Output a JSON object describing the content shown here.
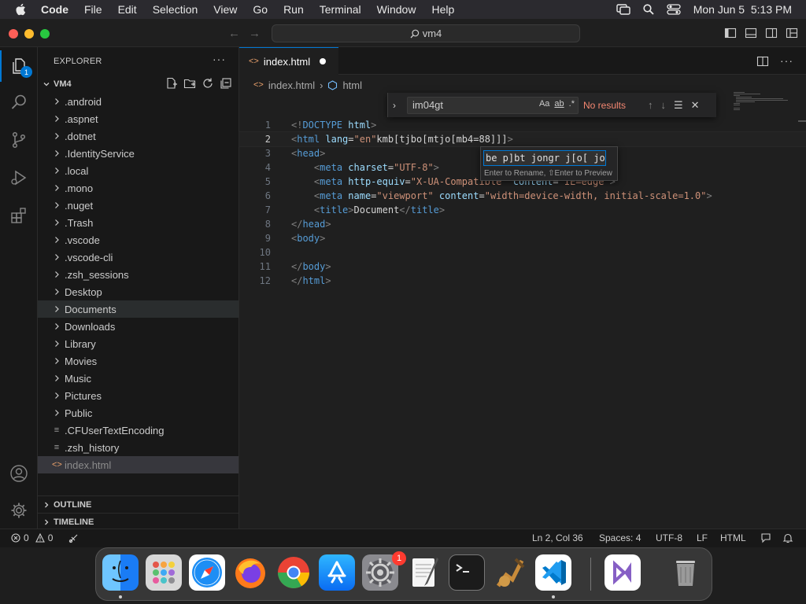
{
  "menubar": {
    "app_name": "Code",
    "items": [
      "File",
      "Edit",
      "Selection",
      "View",
      "Go",
      "Run",
      "Terminal",
      "Window",
      "Help"
    ],
    "datetime": "Mon Jun 5  5:13 PM"
  },
  "titlebar": {
    "search_label": "vm4"
  },
  "activitybar": {
    "explorer_badge": "1"
  },
  "sidebar": {
    "title": "EXPLORER",
    "more_actions": "···",
    "root": "VM4",
    "items": [
      {
        "label": ".android",
        "kind": "folder"
      },
      {
        "label": ".aspnet",
        "kind": "folder"
      },
      {
        "label": ".dotnet",
        "kind": "folder"
      },
      {
        "label": ".IdentityService",
        "kind": "folder"
      },
      {
        "label": ".local",
        "kind": "folder"
      },
      {
        "label": ".mono",
        "kind": "folder"
      },
      {
        "label": ".nuget",
        "kind": "folder"
      },
      {
        "label": ".Trash",
        "kind": "folder"
      },
      {
        "label": ".vscode",
        "kind": "folder"
      },
      {
        "label": ".vscode-cli",
        "kind": "folder"
      },
      {
        "label": ".zsh_sessions",
        "kind": "folder"
      },
      {
        "label": "Desktop",
        "kind": "folder"
      },
      {
        "label": "Documents",
        "kind": "folder"
      },
      {
        "label": "Downloads",
        "kind": "folder"
      },
      {
        "label": "Library",
        "kind": "folder"
      },
      {
        "label": "Movies",
        "kind": "folder"
      },
      {
        "label": "Music",
        "kind": "folder"
      },
      {
        "label": "Pictures",
        "kind": "folder"
      },
      {
        "label": "Public",
        "kind": "folder"
      },
      {
        "label": ".CFUserTextEncoding",
        "kind": "file"
      },
      {
        "label": ".zsh_history",
        "kind": "file"
      },
      {
        "label": "index.html",
        "kind": "html"
      }
    ],
    "outline": "OUTLINE",
    "timeline": "TIMELINE"
  },
  "editor": {
    "tab_label": "index.html",
    "breadcrumb_file": "index.html",
    "breadcrumb_symbol": "html",
    "line_numbers": [
      "1",
      "2",
      "3",
      "4",
      "5",
      "6",
      "7",
      "8",
      "9",
      "10",
      "11",
      "12"
    ],
    "lines": [
      [
        [
          "br",
          "<!"
        ],
        [
          "tg",
          "DOCTYPE"
        ],
        [
          "pl",
          " "
        ],
        [
          "at",
          "html"
        ],
        [
          "br",
          ">"
        ]
      ],
      [
        [
          "br",
          "<"
        ],
        [
          "tg",
          "html"
        ],
        [
          "pl",
          " "
        ],
        [
          "at",
          "lang"
        ],
        [
          "pl",
          "="
        ],
        [
          "st",
          "\"en\""
        ],
        [
          "pl",
          "kmb[tjbo[mtjo[mb4=88]]]"
        ],
        [
          "br",
          ">"
        ]
      ],
      [
        [
          "br",
          "<"
        ],
        [
          "tg",
          "head"
        ],
        [
          "br",
          ">"
        ]
      ],
      [
        [
          "pl",
          "    "
        ],
        [
          "br",
          "<"
        ],
        [
          "tg",
          "meta"
        ],
        [
          "pl",
          " "
        ],
        [
          "at",
          "charset"
        ],
        [
          "pl",
          "="
        ],
        [
          "st",
          "\"UTF-8\""
        ],
        [
          "br",
          ">"
        ]
      ],
      [
        [
          "pl",
          "    "
        ],
        [
          "br",
          "<"
        ],
        [
          "tg",
          "meta"
        ],
        [
          "pl",
          " "
        ],
        [
          "at",
          "http-equiv"
        ],
        [
          "pl",
          "="
        ],
        [
          "st",
          "\"X-UA-Compatible\""
        ],
        [
          "pl",
          " "
        ],
        [
          "at",
          "content"
        ],
        [
          "pl",
          "="
        ],
        [
          "st",
          "\"IE=edge\""
        ],
        [
          "br",
          ">"
        ]
      ],
      [
        [
          "pl",
          "    "
        ],
        [
          "br",
          "<"
        ],
        [
          "tg",
          "meta"
        ],
        [
          "pl",
          " "
        ],
        [
          "at",
          "name"
        ],
        [
          "pl",
          "="
        ],
        [
          "st",
          "\"viewport\""
        ],
        [
          "pl",
          " "
        ],
        [
          "at",
          "content"
        ],
        [
          "pl",
          "="
        ],
        [
          "st",
          "\"width=device-width, initial-scale=1.0\""
        ],
        [
          "br",
          ">"
        ]
      ],
      [
        [
          "pl",
          "    "
        ],
        [
          "br",
          "<"
        ],
        [
          "tg",
          "title"
        ],
        [
          "br",
          ">"
        ],
        [
          "pl",
          "Document"
        ],
        [
          "br",
          "</"
        ],
        [
          "tg",
          "title"
        ],
        [
          "br",
          ">"
        ]
      ],
      [
        [
          "br",
          "</"
        ],
        [
          "tg",
          "head"
        ],
        [
          "br",
          ">"
        ]
      ],
      [
        [
          "br",
          "<"
        ],
        [
          "tg",
          "body"
        ],
        [
          "br",
          ">"
        ]
      ],
      [],
      [
        [
          "br",
          "</"
        ],
        [
          "tg",
          "body"
        ],
        [
          "br",
          ">"
        ]
      ],
      [
        [
          "br",
          "</"
        ],
        [
          "tg",
          "html"
        ],
        [
          "br",
          ">"
        ]
      ]
    ]
  },
  "find_widget": {
    "query": "im04gt",
    "opt_case": "Aa",
    "opt_word": "ab",
    "opt_regex": ".*",
    "status": "No results"
  },
  "rename_widget": {
    "value": "be p]bt jongr j[o[ jo",
    "hint": "Enter to Rename, ⇧Enter to Preview"
  },
  "statusbar": {
    "errors": "0",
    "warnings": "0",
    "position": "Ln 2, Col 36",
    "spaces": "Spaces: 4",
    "encoding": "UTF-8",
    "eol": "LF",
    "language": "HTML"
  },
  "dock": {
    "apps": [
      "finder",
      "launchpad",
      "safari",
      "firefox",
      "chrome",
      "app-store",
      "system-settings",
      "textedit",
      "terminal",
      "instruments",
      "vscode",
      "visual-studio",
      "trash"
    ],
    "settings_badge": "1"
  }
}
